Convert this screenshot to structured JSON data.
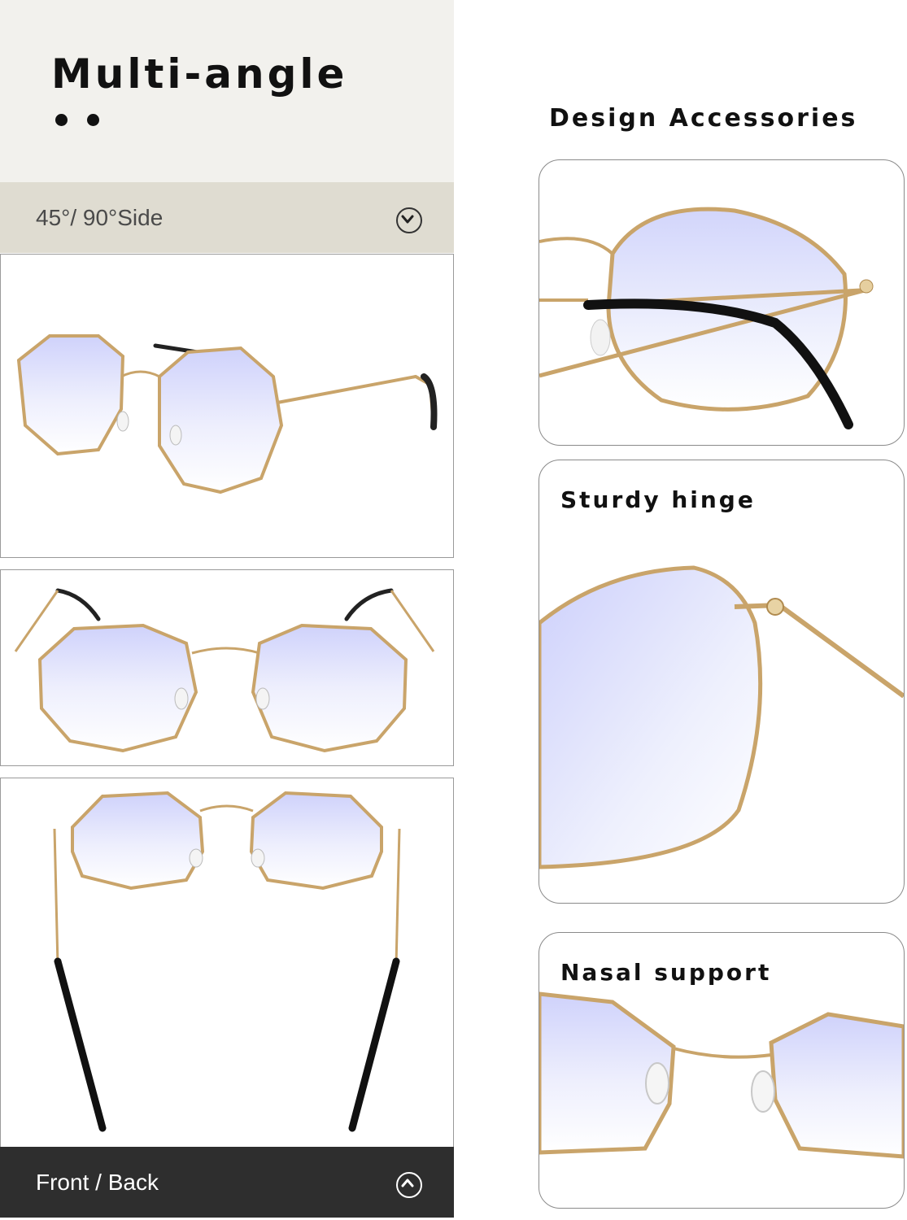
{
  "header": {
    "title": "Multi-angle"
  },
  "angle_band": {
    "label": "45°/ 90°Side",
    "icon": "chevron-down-circle-icon"
  },
  "front_band": {
    "label": "Front / Back",
    "icon": "chevron-up-circle-icon"
  },
  "right": {
    "section_title": "Design Accessories",
    "cards": [
      {
        "label": ""
      },
      {
        "label": "Sturdy hinge"
      },
      {
        "label": "Nasal support"
      }
    ]
  },
  "colors": {
    "gold": "#c9a46a",
    "lens": "#dfe2fb",
    "header_bg": "#f2f1ed",
    "band_light": "#dfdcd1",
    "band_dark": "#2e2e2e"
  }
}
